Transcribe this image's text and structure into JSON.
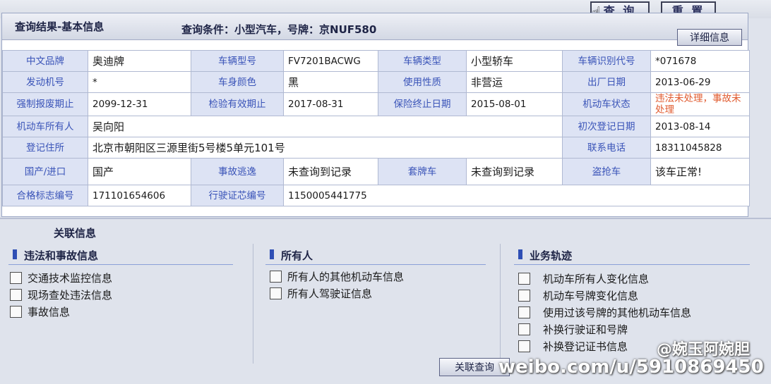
{
  "toolbar": {
    "query_label": "查 询",
    "reset_label": "重 置"
  },
  "panel": {
    "title": "查询结果-基本信息",
    "query_condition_label": "查询条件：",
    "query_condition_value": "小型汽车，号牌：京NUF580",
    "detail_button": "详细信息"
  },
  "info": {
    "r1": [
      "中文品牌",
      "奥迪牌",
      "车辆型号",
      "FV7201BACWG",
      "车辆类型",
      "小型轿车",
      "车辆识别代号",
      "*071678"
    ],
    "r2": [
      "发动机号",
      "*",
      "车身颜色",
      "黑",
      "使用性质",
      "非营运",
      "出厂日期",
      "2013-06-29"
    ],
    "r3": [
      "强制报废期止",
      "2099-12-31",
      "检验有效期止",
      "2017-08-31",
      "保险终止日期",
      "2015-08-01",
      "机动车状态",
      "违法未处理，事故未处理"
    ],
    "r4": [
      "机动车所有人",
      "吴向阳",
      "初次登记日期",
      "2013-08-14"
    ],
    "r5": [
      "登记住所",
      "北京市朝阳区三源里街5号楼5单元101号",
      "联系电话",
      "18311045828"
    ],
    "r6": [
      "国产/进口",
      "国产",
      "事故逃逸",
      "未查询到记录",
      "套牌车",
      "未查询到记录",
      "盗抢车",
      "该车正常!"
    ],
    "r7": [
      "合格标志编号",
      "171101654606",
      "行驶证芯编号",
      "1150005441775"
    ]
  },
  "related": {
    "title": "关联信息",
    "sections": [
      {
        "title": "违法和事故信息",
        "items": [
          "交通技术监控信息",
          "现场查处违法信息",
          "事故信息"
        ]
      },
      {
        "title": "所有人",
        "items": [
          "所有人的其他机动车信息",
          "所有人驾驶证信息"
        ]
      },
      {
        "title": "业务轨迹",
        "items": [
          "机动车所有人变化信息",
          "机动车号牌变化信息",
          "使用过该号牌的其他机动车信息",
          "补换行驶证和号牌",
          "补换登记证书信息"
        ]
      }
    ],
    "related_button": "关联查询"
  },
  "watermark": {
    "name": "@婉玉阿婉胆",
    "url": "weibo.com/u/5910869450"
  },
  "colors": {
    "label_text": "#3a54b8",
    "label_bg": "#dde3f4",
    "status_red": "#e05a2e",
    "section_bar": "#2f4fb5"
  }
}
